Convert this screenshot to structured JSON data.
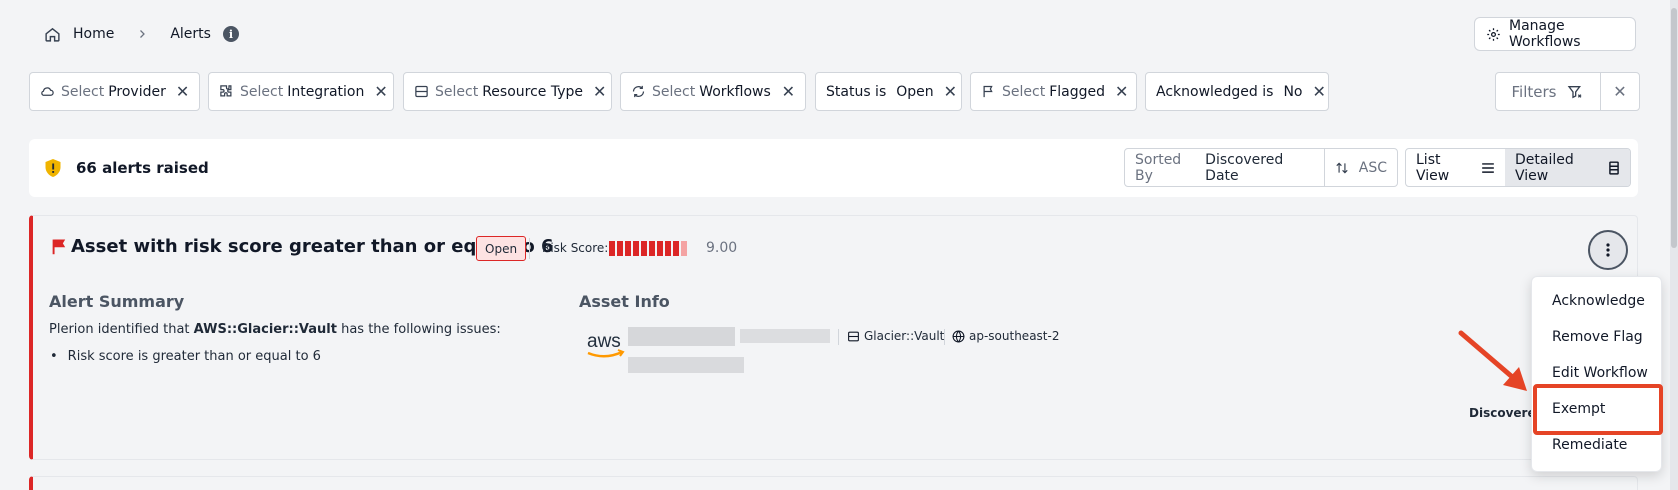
{
  "breadcrumb": {
    "home": "Home",
    "current": "Alerts"
  },
  "header": {
    "manage_workflows": "Manage Workflows"
  },
  "filters": [
    {
      "prefix": "Select",
      "value": "Provider",
      "icon": "cloud-icon"
    },
    {
      "prefix": "Select",
      "value": "Integration",
      "icon": "puzzle-icon"
    },
    {
      "prefix": "Select",
      "value": "Resource Type",
      "icon": "server-icon"
    },
    {
      "prefix": "Select",
      "value": "Workflows",
      "icon": "sync-icon"
    },
    {
      "prefix": "Status is",
      "value": "Open",
      "icon": ""
    },
    {
      "prefix": "Select",
      "value": "Flagged",
      "icon": "flag-icon"
    },
    {
      "prefix": "Acknowledged is",
      "value": "No",
      "icon": ""
    }
  ],
  "filters_button": "Filters",
  "alerts_summary": {
    "count_text": "66 alerts raised"
  },
  "sort": {
    "label": "Sorted By",
    "value": "Discovered Date",
    "order": "ASC"
  },
  "views": {
    "list": "List View",
    "detailed": "Detailed View"
  },
  "alert": {
    "title": "Asset with risk score greater than or equal to 6",
    "status": "Open",
    "risk_label": "Risk Score:",
    "risk_value": "9.00",
    "risk_score": 9.0,
    "risk_max": 10,
    "summary_heading": "Alert Summary",
    "summary_prefix": "Plerion identified that ",
    "summary_resource": "AWS::Glacier::Vault",
    "summary_suffix": " has the following issues:",
    "issues": [
      "Risk score is greater than or equal to 6"
    ],
    "asset_heading": "Asset Info",
    "asset_type": "Glacier::Vault",
    "asset_region": "ap-southeast-2",
    "discovered_label": "Discovered"
  },
  "menu": {
    "items": [
      "Acknowledge",
      "Remove Flag",
      "Edit Workflow",
      "Exempt",
      "Remediate"
    ],
    "highlighted": "Exempt"
  },
  "colors": {
    "accent_red": "#dc2626",
    "highlight": "#e54426",
    "shield": "#f0b400"
  }
}
